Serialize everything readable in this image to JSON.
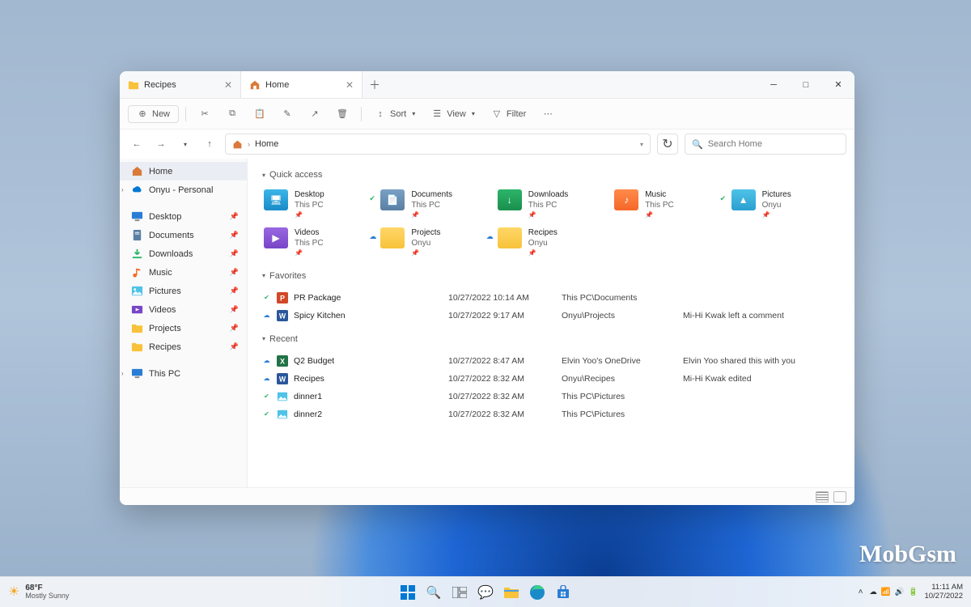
{
  "tabs": [
    {
      "label": "Recipes",
      "active": false
    },
    {
      "label": "Home",
      "active": true
    }
  ],
  "window": {
    "minimize": "─",
    "maximize": "□",
    "close": "✕"
  },
  "toolbar": {
    "new_label": "New",
    "sort_label": "Sort",
    "view_label": "View",
    "filter_label": "Filter"
  },
  "addressbar": {
    "location": "Home",
    "search_placeholder": "Search Home"
  },
  "sidebar": {
    "home": "Home",
    "onedrive": "Onyu - Personal",
    "pinned": [
      {
        "name": "Desktop",
        "icon": "desktop"
      },
      {
        "name": "Documents",
        "icon": "documents"
      },
      {
        "name": "Downloads",
        "icon": "downloads"
      },
      {
        "name": "Music",
        "icon": "music"
      },
      {
        "name": "Pictures",
        "icon": "pictures"
      },
      {
        "name": "Videos",
        "icon": "videos"
      },
      {
        "name": "Projects",
        "icon": "folder"
      },
      {
        "name": "Recipes",
        "icon": "folder"
      }
    ],
    "thispc": "This PC"
  },
  "sections": {
    "quick_access": "Quick access",
    "favorites": "Favorites",
    "recent": "Recent"
  },
  "quick_access": [
    {
      "name": "Desktop",
      "location": "This PC",
      "color": "blue",
      "glyph": "🖥"
    },
    {
      "name": "Documents",
      "location": "This PC",
      "color": "slate",
      "glyph": "📄",
      "sync": "green"
    },
    {
      "name": "Downloads",
      "location": "This PC",
      "color": "green",
      "glyph": "↓"
    },
    {
      "name": "Music",
      "location": "This PC",
      "color": "orange",
      "glyph": "♪"
    },
    {
      "name": "Pictures",
      "location": "Onyu",
      "color": "cyan",
      "glyph": "▲",
      "sync": "green"
    },
    {
      "name": "Videos",
      "location": "This PC",
      "color": "purple",
      "glyph": "▶"
    },
    {
      "name": "Projects",
      "location": "Onyu",
      "color": "yellow",
      "glyph": "",
      "sync": "cloud"
    },
    {
      "name": "Recipes",
      "location": "Onyu",
      "color": "yellow",
      "glyph": "",
      "sync": "cloud"
    }
  ],
  "favorites": [
    {
      "name": "PR Package",
      "icon": "ppt",
      "sync": "green",
      "date": "10/27/2022 10:14 AM",
      "path": "This PC\\Documents",
      "status": ""
    },
    {
      "name": "Spicy Kitchen",
      "icon": "word",
      "sync": "cloud",
      "date": "10/27/2022 9:17 AM",
      "path": "Onyu\\Projects",
      "status": "Mi-Hi Kwak left a comment"
    }
  ],
  "recent": [
    {
      "name": "Q2 Budget",
      "icon": "excel",
      "sync": "cloud",
      "date": "10/27/2022 8:47 AM",
      "path": "Elvin Yoo's OneDrive",
      "status": "Elvin Yoo shared this with you"
    },
    {
      "name": "Recipes",
      "icon": "word",
      "sync": "cloud",
      "date": "10/27/2022 8:32 AM",
      "path": "Onyu\\Recipes",
      "status": "Mi-Hi Kwak edited"
    },
    {
      "name": "dinner1",
      "icon": "image",
      "sync": "green",
      "date": "10/27/2022 8:32 AM",
      "path": "This PC\\Pictures",
      "status": ""
    },
    {
      "name": "dinner2",
      "icon": "image",
      "sync": "green",
      "date": "10/27/2022 8:32 AM",
      "path": "This PC\\Pictures",
      "status": ""
    }
  ],
  "taskbar": {
    "weather_temp": "68°F",
    "weather_desc": "Mostly Sunny",
    "time": "11:11 AM",
    "date": "10/27/2022"
  },
  "watermark": "MobGsm"
}
